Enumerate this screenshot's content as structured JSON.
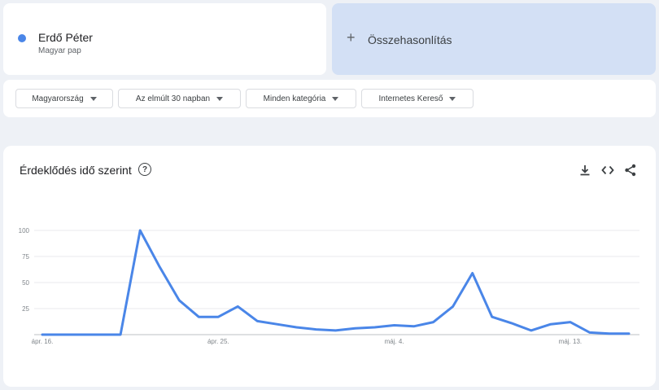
{
  "term": {
    "name": "Erdő Péter",
    "subtitle": "Magyar pap",
    "color": "#4a86e8"
  },
  "compare": {
    "plus_icon": "plus-icon",
    "label": "Összehasonlítás"
  },
  "filters": {
    "region": "Magyarország",
    "timeframe": "Az elmúlt 30 napban",
    "category": "Minden kategória",
    "search_type": "Internetes Kereső"
  },
  "chart_card": {
    "title": "Érdeklődés idő szerint",
    "help_icon": "help-circle-icon",
    "tools": [
      "download-icon",
      "embed-code-icon",
      "share-icon"
    ]
  },
  "chart_data": {
    "type": "line",
    "title": "",
    "xlabel": "",
    "ylabel": "",
    "ylim": [
      0,
      100
    ],
    "y_ticks": [
      100,
      75,
      50,
      25
    ],
    "x_tick_labels": [
      {
        "index": 0,
        "label": "ápr. 16."
      },
      {
        "index": 9,
        "label": "ápr. 25."
      },
      {
        "index": 18,
        "label": "máj. 4."
      },
      {
        "index": 27,
        "label": "máj. 13."
      }
    ],
    "grid": true,
    "series": [
      {
        "color": "#4a86e8",
        "values": [
          0,
          0,
          0,
          0,
          0,
          100,
          65,
          33,
          17,
          17,
          27,
          13,
          10,
          7,
          5,
          4,
          6,
          7,
          9,
          8,
          12,
          27,
          59,
          17,
          11,
          4,
          10,
          12,
          2,
          1,
          1
        ]
      }
    ]
  }
}
